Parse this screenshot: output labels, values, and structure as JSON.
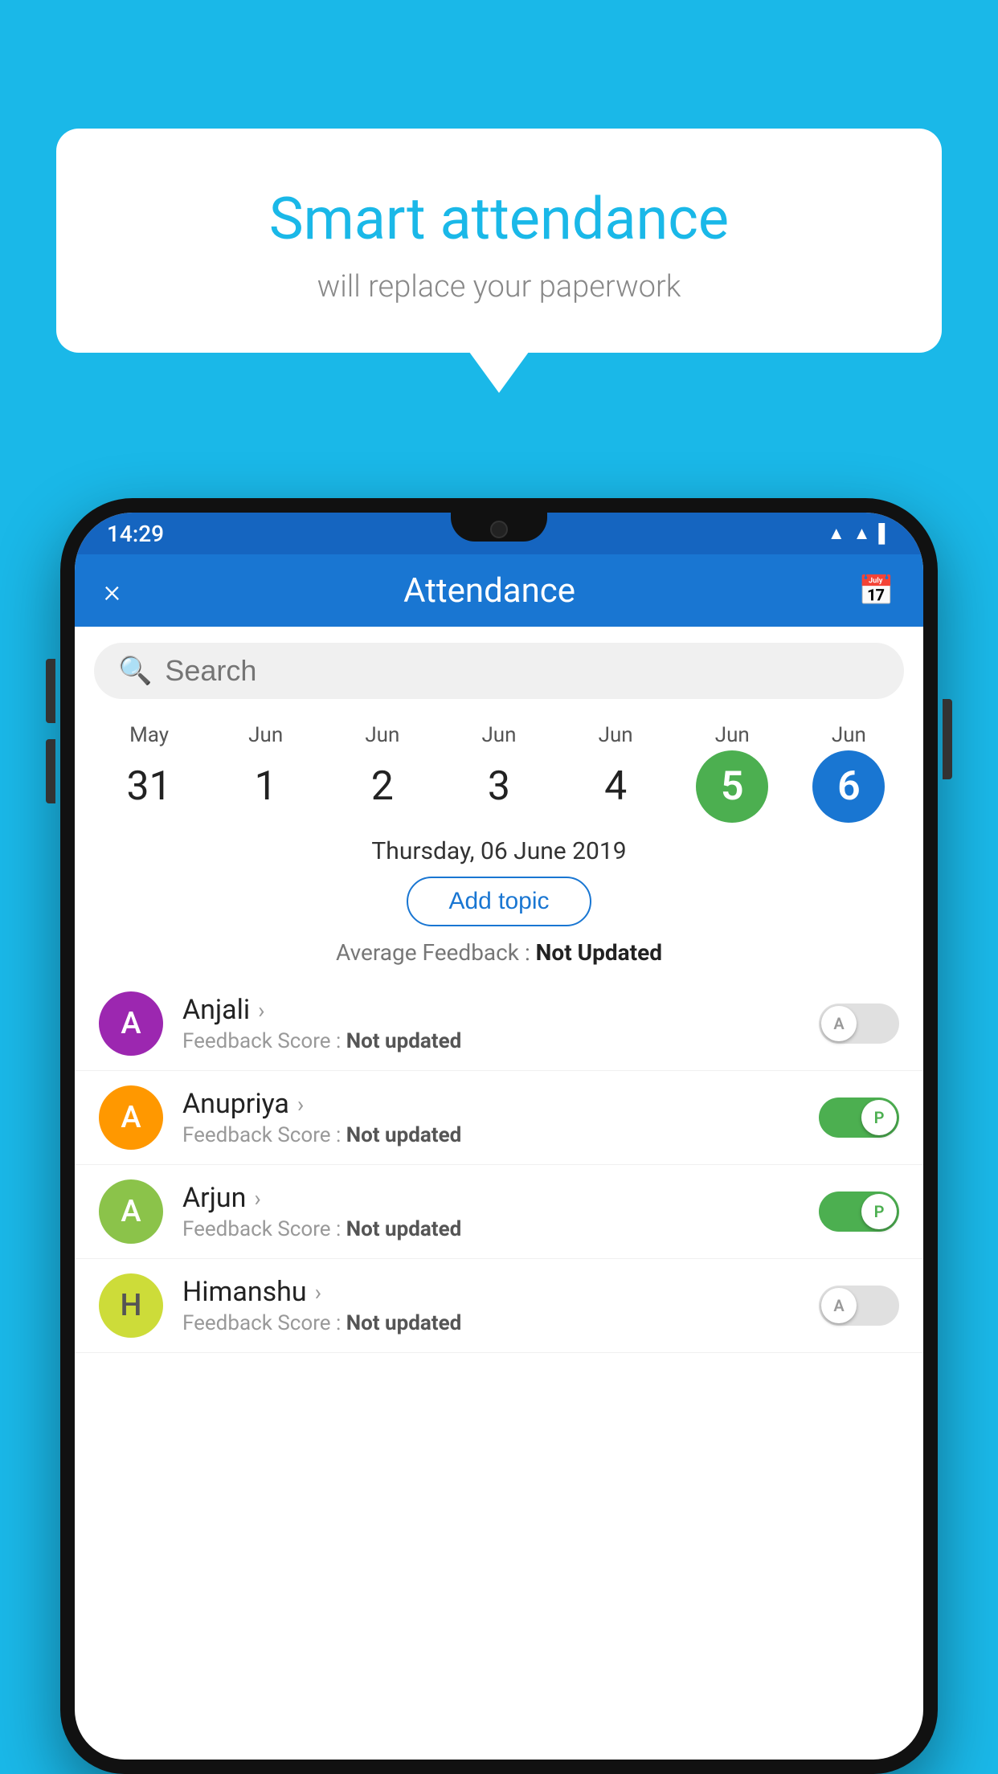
{
  "background": {
    "color": "#1ab8e8"
  },
  "speech_bubble": {
    "title": "Smart attendance",
    "subtitle": "will replace your paperwork"
  },
  "status_bar": {
    "time": "14:29",
    "icons": [
      "wifi",
      "signal",
      "battery"
    ]
  },
  "header": {
    "title": "Attendance",
    "close_label": "×",
    "calendar_label": "📅"
  },
  "search": {
    "placeholder": "Search"
  },
  "calendar": {
    "dates": [
      {
        "month": "May",
        "day": "31",
        "state": "normal"
      },
      {
        "month": "Jun",
        "day": "1",
        "state": "normal"
      },
      {
        "month": "Jun",
        "day": "2",
        "state": "normal"
      },
      {
        "month": "Jun",
        "day": "3",
        "state": "normal"
      },
      {
        "month": "Jun",
        "day": "4",
        "state": "normal"
      },
      {
        "month": "Jun",
        "day": "5",
        "state": "today"
      },
      {
        "month": "Jun",
        "day": "6",
        "state": "selected"
      }
    ]
  },
  "selected_date": "Thursday, 06 June 2019",
  "add_topic_label": "Add topic",
  "avg_feedback": {
    "label": "Average Feedback : ",
    "value": "Not Updated"
  },
  "students": [
    {
      "name": "Anjali",
      "avatar_letter": "A",
      "avatar_color": "purple",
      "score_label": "Feedback Score : ",
      "score_value": "Not updated",
      "toggle_state": "off",
      "toggle_label": "A"
    },
    {
      "name": "Anupriya",
      "avatar_letter": "A",
      "avatar_color": "orange",
      "score_label": "Feedback Score : ",
      "score_value": "Not updated",
      "toggle_state": "on",
      "toggle_label": "P"
    },
    {
      "name": "Arjun",
      "avatar_letter": "A",
      "avatar_color": "green",
      "score_label": "Feedback Score : ",
      "score_value": "Not updated",
      "toggle_state": "on",
      "toggle_label": "P"
    },
    {
      "name": "Himanshu",
      "avatar_letter": "H",
      "avatar_color": "lime",
      "score_label": "Feedback Score : ",
      "score_value": "Not updated",
      "toggle_state": "off",
      "toggle_label": "A"
    }
  ]
}
